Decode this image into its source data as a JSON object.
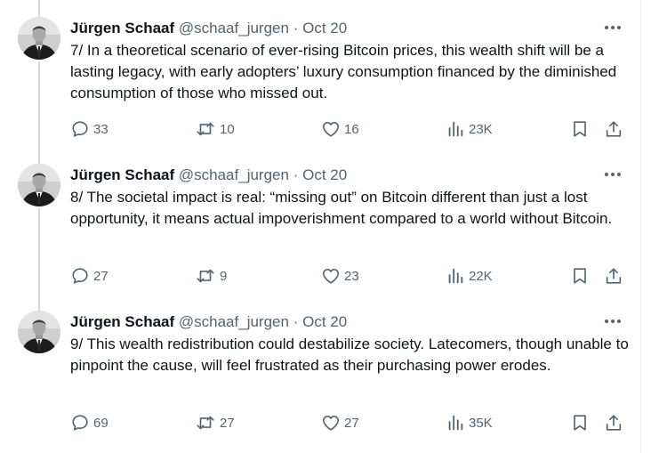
{
  "tweets": [
    {
      "author": "Jürgen Schaaf",
      "handle": "@schaaf_jurgen",
      "separator": "·",
      "time": "Oct 20",
      "text": "7/ In a theoretical scenario of ever-rising Bitcoin prices, this wealth shift will be a lasting legacy, with early adopters’ luxury consumption financed by the diminished consumption of those who missed out.",
      "replies": "33",
      "retweets": "10",
      "likes": "16",
      "views": "23K"
    },
    {
      "author": "Jürgen Schaaf",
      "handle": "@schaaf_jurgen",
      "separator": "·",
      "time": "Oct 20",
      "text": "8/ The societal impact is real: “missing out” on Bitcoin different than just a lost opportunity, it means actual impoverishment compared to a world without Bitcoin.",
      "replies": "27",
      "retweets": "9",
      "likes": "23",
      "views": "22K"
    },
    {
      "author": "Jürgen Schaaf",
      "handle": "@schaaf_jurgen",
      "separator": "·",
      "time": "Oct 20",
      "text": "9/ This wealth redistribution could destabilize society. Latecomers, though unable to pinpoint the cause, will feel frustrated as their purchasing power erodes.",
      "replies": "69",
      "retweets": "27",
      "likes": "27",
      "views": "35K"
    }
  ],
  "icons": {
    "more": "more-horizontal-icon",
    "reply": "reply-bubble-icon",
    "retweet": "retweet-icon",
    "like": "heart-icon",
    "views": "analytics-bars-icon",
    "bookmark": "bookmark-icon",
    "share": "share-upload-icon"
  },
  "colors": {
    "text": "#0f1419",
    "secondary": "#536471",
    "thread_line": "#cfd9de"
  }
}
